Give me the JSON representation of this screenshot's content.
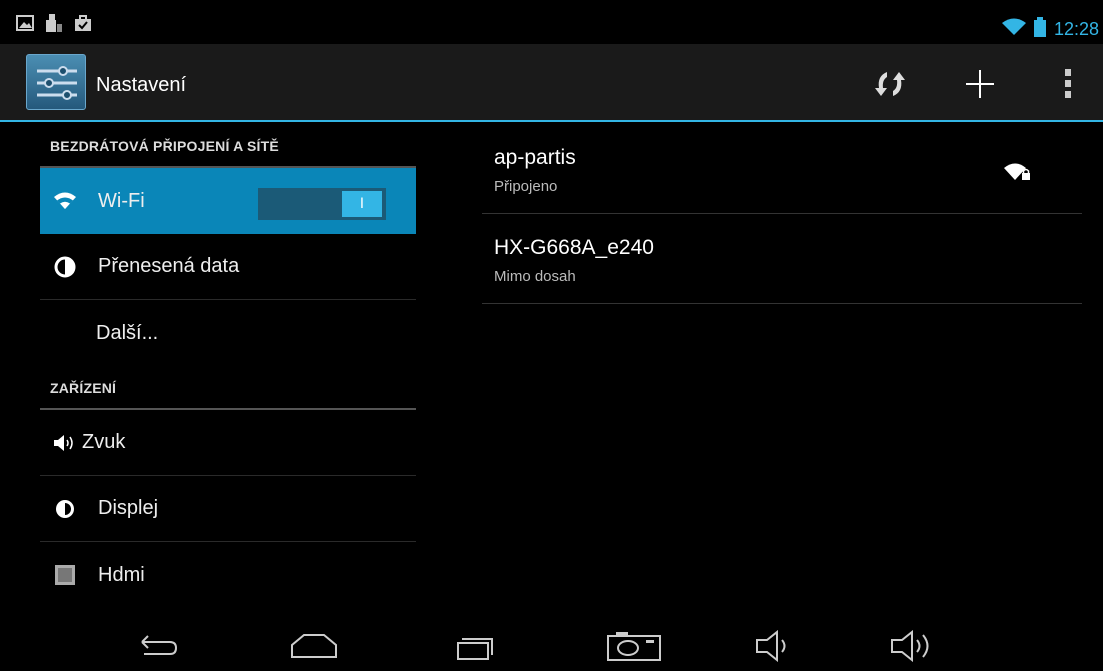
{
  "status_bar": {
    "time": "12:28",
    "left_icons": [
      "picture-notification-icon",
      "usb-notification-icon",
      "store-notification-icon"
    ],
    "right_icons": [
      "wifi-status-icon",
      "battery-icon"
    ]
  },
  "action_bar": {
    "title": "Nastavení",
    "actions": [
      "scan-wifi-icon",
      "add-network-icon",
      "overflow-menu-icon"
    ]
  },
  "settings": {
    "sections": [
      {
        "header": "BEZDRÁTOVÁ PŘIPOJENÍ A SÍTĚ",
        "items": [
          {
            "label": "Wi-Fi",
            "icon": "wifi-icon",
            "selected": true,
            "toggle": "I"
          },
          {
            "label": "Přenesená data",
            "icon": "data-usage-icon"
          },
          {
            "label": "Další...",
            "icon": ""
          }
        ]
      },
      {
        "header": "ZAŘÍZENÍ",
        "items": [
          {
            "label": "Zvuk",
            "icon": "sound-icon"
          },
          {
            "label": "Displej",
            "icon": "display-icon"
          },
          {
            "label": "Hdmi",
            "icon": "hdmi-icon"
          }
        ]
      }
    ]
  },
  "networks": [
    {
      "name": "ap-partis",
      "status": "Připojeno",
      "secured": true
    },
    {
      "name": "HX-G668A_e240",
      "status": "Mimo dosah",
      "secured": false
    }
  ],
  "nav_bar": [
    "back-icon",
    "home-icon",
    "recent-apps-icon",
    "screenshot-icon",
    "volume-down-icon",
    "volume-up-icon"
  ],
  "colors": {
    "accent": "#33b5e5",
    "selected": "#0a86b8"
  }
}
